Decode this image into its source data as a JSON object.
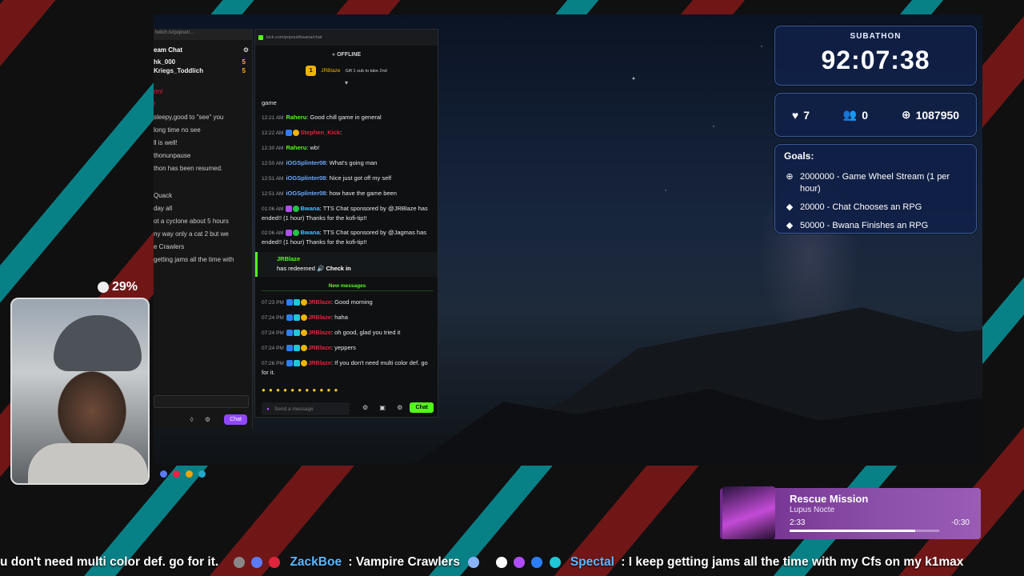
{
  "bg_chat": {
    "url": "twitch.tv/popout/...",
    "title": "eam Chat",
    "viewers": [
      {
        "name": "hk_000",
        "count": "5"
      },
      {
        "name": "Kriegs_Toddlich",
        "count": "5"
      }
    ],
    "lines": [
      "rm!",
      "!",
      "sleepy,good to \"see\" you",
      "long time no see",
      "ll is well!",
      "thonunpause",
      "thon has been resumed.",
      "Quack",
      "day all",
      "ot a cyclone about 5 hours",
      "ny way   only a cat 2 but we",
      "e Crawlers",
      "getting jams all the time with"
    ],
    "chat_label": "Chat"
  },
  "kick": {
    "url": "kick.com/popout/bwana/chat",
    "status": "OFFLINE",
    "pinned_user": "JRBlaze",
    "pinned_text": "Gift 1 sub to take 2nd",
    "messages": [
      {
        "time": "",
        "user": "",
        "text": "game"
      },
      {
        "time": "12:21 AM",
        "user": "Raheru",
        "text": ": Good chill game in general"
      },
      {
        "time": "12:22 AM",
        "user": "Stephen_Kick",
        "text": ":"
      },
      {
        "time": "12:30 AM",
        "user": "Raheru",
        "text": ":    wb!"
      },
      {
        "time": "12:50 AM",
        "user": "iOGSplinter08",
        "text": ": What's going man"
      },
      {
        "time": "12:51 AM",
        "user": "iOGSplinter08",
        "text": ": Nice just got off my self"
      },
      {
        "time": "12:51 AM",
        "user": "iOGSplinter08",
        "text": ": how have the game been"
      },
      {
        "time": "01:06 AM",
        "user": "Bwana",
        "text": ": TTS Chat sponsored by @JRBlaze has ended!! (1 hour) Thanks for the kofi-tip!!"
      },
      {
        "time": "02:06 AM",
        "user": "Bwana",
        "text": ": TTS Chat sponsored by @Jagmas  has ended!! (1 hour) Thanks for the kofi-tip!!"
      }
    ],
    "redeem": {
      "user": "JRBlaze",
      "text": "has redeemed",
      "reward": "Check in"
    },
    "new_messages_label": "New messages",
    "new_messages": [
      {
        "time": "07:23 PM",
        "user": "JRBlaze",
        "text": ": Good morning"
      },
      {
        "time": "07:24 PM",
        "user": "JRBlaze",
        "text": ": haha"
      },
      {
        "time": "07:24 PM",
        "user": "JRBlaze",
        "text": ": oh good, glad you tried it"
      },
      {
        "time": "07:24 PM",
        "user": "JRBlaze",
        "text": ": yeppers"
      },
      {
        "time": "07:26 PM",
        "user": "JRBlaze",
        "text": ": If you don't need multi color def. go for it."
      }
    ],
    "input_placeholder": "Send a message",
    "chat_button": "Chat"
  },
  "cam": {
    "percent": "29%"
  },
  "subathon": {
    "label": "SUBATHON",
    "timer": "92:07:38"
  },
  "stats": {
    "likes": "7",
    "followers": "0",
    "points": "1087950"
  },
  "goals": {
    "heading": "Goals:",
    "items": [
      {
        "icon": "plus-circle-icon",
        "text": "2000000 - Game Wheel Stream (1 per hour)"
      },
      {
        "icon": "diamond-icon",
        "text": "20000 - Chat Chooses an RPG"
      },
      {
        "icon": "diamond-icon",
        "text": "50000 - Bwana Finishes an RPG"
      }
    ]
  },
  "now_playing": {
    "title": "Rescue Mission",
    "artist": "Lupus Nocte",
    "current": "2:33",
    "remaining": "-0:30",
    "progress": 0.84
  },
  "ticker": {
    "pre": "u don't need multi color def. go for it.",
    "user1": "ZackBoe",
    "msg1": ": Vampire Crawlers",
    "user2": "Spectal",
    "msg2": ": I keep getting jams all the time with my Cfs on my k1max"
  },
  "colors": {
    "kick_green": "#53fc18",
    "twitch_purple": "#9147ff",
    "widget_bg": "#102046"
  }
}
